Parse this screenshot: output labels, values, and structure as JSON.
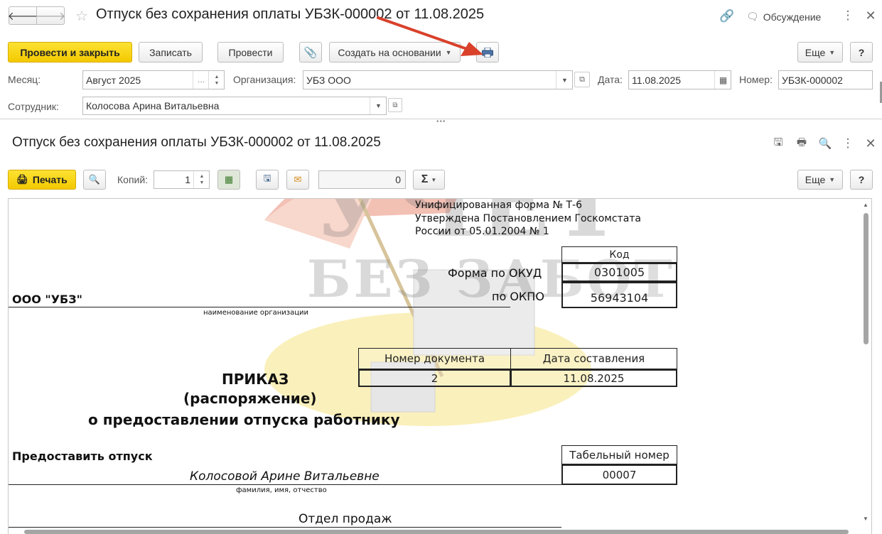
{
  "window": {
    "title": "Отпуск без сохранения оплаты УБЗК-000002 от 11.08.2025",
    "discussion_label": "Обсуждение"
  },
  "toolbar": {
    "post_close_label": "Провести и закрыть",
    "save_label": "Записать",
    "post_label": "Провести",
    "create_based_label": "Создать на основании",
    "more_label": "Еще",
    "help_label": "?"
  },
  "form": {
    "month_label": "Месяц:",
    "month_value": "Август 2025",
    "org_label": "Организация:",
    "org_value": "УБЗ ООО",
    "date_label": "Дата:",
    "date_value": "11.08.2025",
    "number_label": "Номер:",
    "number_value": "УБЗК-000002",
    "employee_label": "Сотрудник:",
    "employee_value": "Колосова Арина Витальевна"
  },
  "print_panel": {
    "title": "Отпуск без сохранения оплаты УБЗК-000002 от 11.08.2025",
    "print_label": "Печать",
    "copies_label": "Копий:",
    "copies_value": "1",
    "sum_value": "0",
    "sigma": "Σ",
    "more_label": "Еще",
    "help_label": "?"
  },
  "document": {
    "form_line1": "Унифицированная форма № Т-6",
    "form_line2": "Утверждена Постановлением Госкомстата",
    "form_line3": "России от 05.01.2004 № 1",
    "code_header": "Код",
    "okud_label": "Форма по ОКУД",
    "okud_value": "0301005",
    "okpo_label": "по ОКПО",
    "okpo_value": "56943104",
    "org_name": "ООО \"УБЗ\"",
    "org_caption": "наименование организации",
    "doc_number_header": "Номер документа",
    "doc_date_header": "Дата составления",
    "doc_number_value": "2",
    "doc_date_value": "11.08.2025",
    "title1": "ПРИКАЗ",
    "title2": "(распоряжение)",
    "title3": "о предоставлении отпуска работнику",
    "grant_label": "Предоставить отпуск",
    "tab_header": "Табельный номер",
    "tab_value": "00007",
    "employee_name": "Колосовой Арине Витальевне",
    "fio_caption": "фамилия, имя, отчество",
    "department": "Отдел продаж"
  },
  "watermark": {
    "line1": "УЧЕТ",
    "line2": "БЕЗ ЗАБОТ"
  },
  "colors": {
    "accent_yellow": "#f5cf0b",
    "arrow_red": "#d9412b"
  }
}
